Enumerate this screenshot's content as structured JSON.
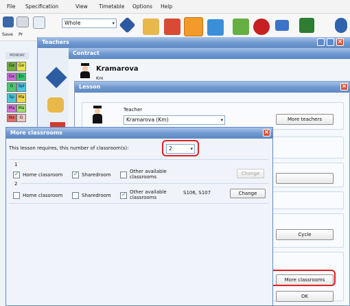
{
  "menu": [
    "File",
    "Specification",
    "View",
    "Timetable",
    "Options",
    "Help"
  ],
  "toolbar": {
    "save_label": "Save",
    "print_label": "Pr",
    "view_combo_value": "Whole"
  },
  "teachers_window": {
    "title": "Teachers"
  },
  "timetable_thumb": {
    "day": "MONDAY",
    "rows": [
      [
        "Ge",
        "Ge"
      ],
      [
        "Ge",
        "En"
      ],
      [
        "G",
        "Spl"
      ],
      [
        "Sp",
        "Ma"
      ],
      [
        "Ma",
        "Ma"
      ],
      [
        "Na",
        "G"
      ]
    ]
  },
  "contract": {
    "title": "Contract",
    "teacher_name": "Kramarova",
    "teacher_short": "Km"
  },
  "lesson": {
    "title": "Lesson",
    "teacher_label": "Teacher",
    "teacher_value": "Kramarova (Km)",
    "more_teachers_btn": "More teachers",
    "cycle_btn": "Cycle",
    "more_classrooms_btn": "More classrooms",
    "ok_btn": "OK"
  },
  "more_classrooms": {
    "title": "More classrooms",
    "requires_label": "This lesson requires, this number of classroom(s):",
    "count_value": "2",
    "groups": [
      {
        "index": "1",
        "home": "Home classroom",
        "home_checked": true,
        "shared": "Sharedroom",
        "shared_checked": true,
        "other": "Other available classrooms",
        "other_checked": false,
        "rooms": "",
        "change": "Change",
        "change_enabled": false
      },
      {
        "index": "2",
        "home": "Home classroom",
        "home_checked": false,
        "shared": "Sharedroom",
        "shared_checked": false,
        "other": "Other available classrooms",
        "other_checked": true,
        "rooms": "S106, S107",
        "change": "Change",
        "change_enabled": true
      }
    ]
  },
  "colors": {
    "title_blue": "#6e97cf",
    "highlight_red": "#e02020",
    "close_red": "#d9533d"
  }
}
